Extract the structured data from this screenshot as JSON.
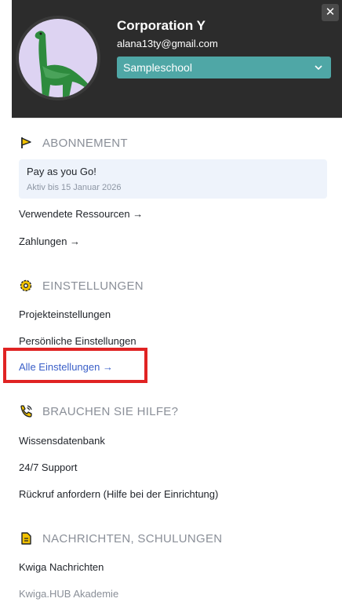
{
  "header": {
    "close_glyph": "✕",
    "org_name": "Corporation Y",
    "email": "alana13ty@gmail.com",
    "school_select": {
      "value": "Sampleschool",
      "icon": "chevron-down-icon"
    },
    "avatar": {
      "icon": "dinosaur-avatar",
      "bg": "#ddd3f2",
      "fg": "#2e8b3e"
    }
  },
  "subscription": {
    "icon": "flag-icon",
    "title": "ABONNEMENT",
    "plan_name": "Pay as you Go!",
    "plan_status": "Aktiv bis 15 Januar 2026",
    "links": [
      "Verwendete Ressourcen →",
      "Zahlungen →"
    ]
  },
  "settings": {
    "icon": "gear-icon",
    "title": "EINSTELLUNGEN",
    "links": [
      "Projekteinstellungen",
      "Persönliche Einstellungen",
      "Alle Einstellungen →"
    ]
  },
  "help": {
    "icon": "phone-icon",
    "title": "BRAUCHEN SIE HILFE?",
    "links": [
      "Wissensdatenbank",
      "24/7 Support",
      "Rückruf anfordern (Hilfe bei der Einrichtung)"
    ]
  },
  "news": {
    "icon": "document-icon",
    "title": "NACHRICHTEN, SCHULUNGEN",
    "links": [
      "Kwiga Nachrichten",
      "Kwiga.HUB Akademie"
    ]
  },
  "colors": {
    "header_bg": "#2c2c2c",
    "select_bg": "#4fa7a6",
    "accent_yellow": "#f2c200",
    "link_blue": "#3a5fc8",
    "highlight_red": "#e02323"
  }
}
